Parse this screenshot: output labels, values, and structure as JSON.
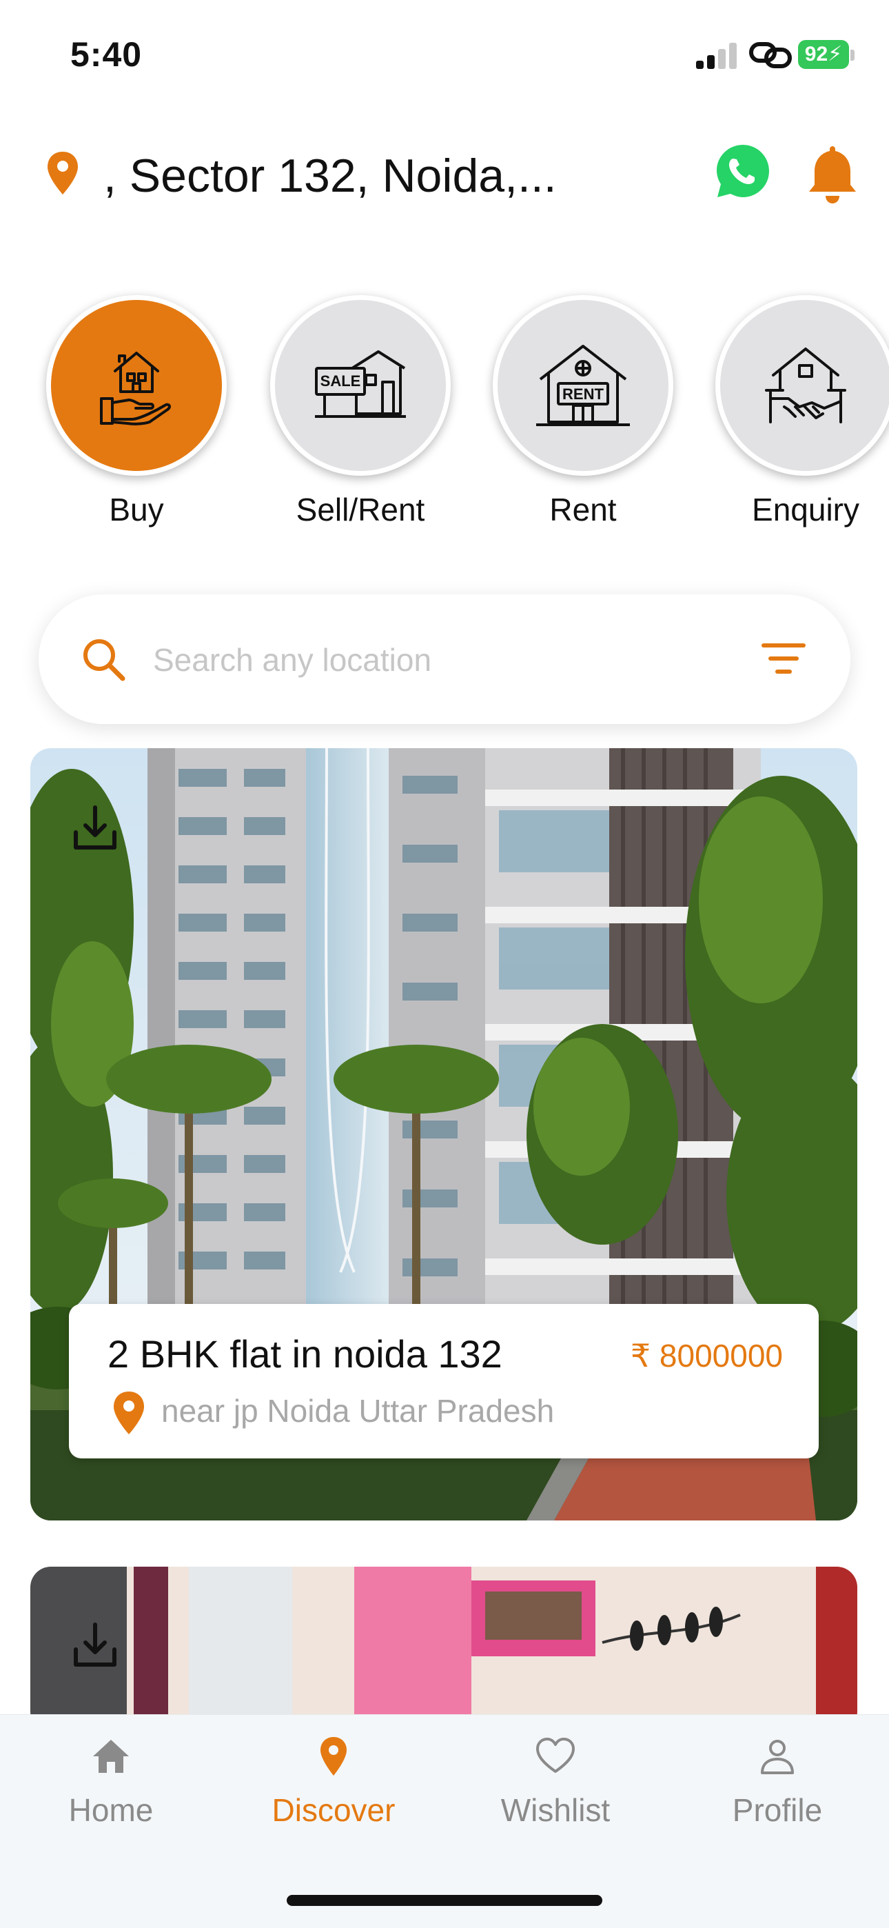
{
  "status_bar": {
    "time": "5:40",
    "battery": "92"
  },
  "header": {
    "location": ", Sector 132, Noida,..."
  },
  "categories": [
    {
      "label": "Buy",
      "icon": "house-hand-icon",
      "active": true
    },
    {
      "label": "Sell/Rent",
      "icon": "sale-house-icon",
      "active": false
    },
    {
      "label": "Rent",
      "icon": "rent-house-icon",
      "active": false
    },
    {
      "label": "Enquiry",
      "icon": "handshake-house-icon",
      "active": false
    }
  ],
  "search": {
    "placeholder": "Search any location"
  },
  "listings": [
    {
      "title": "2 BHK flat in noida 132",
      "price": "₹ 8000000",
      "address": "near jp Noida Uttar Pradesh"
    }
  ],
  "bottom_nav": [
    {
      "label": "Home",
      "icon": "home-icon",
      "active": false
    },
    {
      "label": "Discover",
      "icon": "location-pin-icon",
      "active": true
    },
    {
      "label": "Wishlist",
      "icon": "heart-icon",
      "active": false
    },
    {
      "label": "Profile",
      "icon": "user-icon",
      "active": false
    }
  ],
  "colors": {
    "accent": "#e47911",
    "inactive": "#8a8a8a",
    "circle_bg": "#e2e2e4",
    "whatsapp": "#25d366"
  }
}
